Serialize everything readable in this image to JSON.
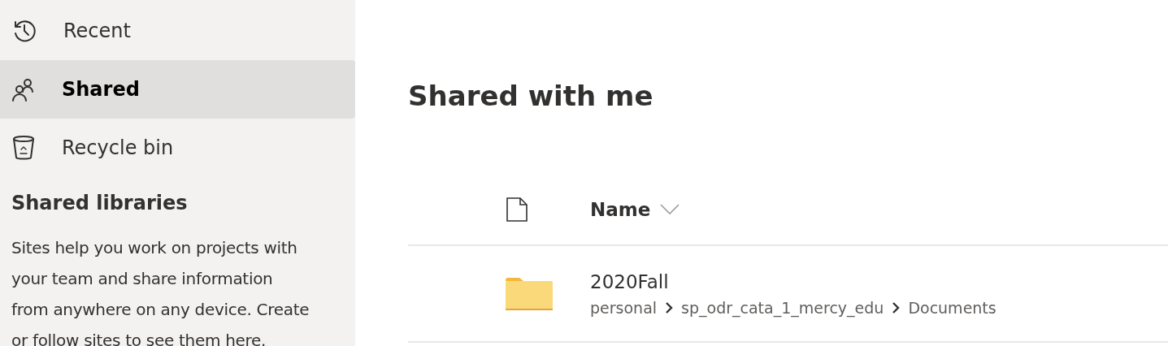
{
  "sidebar": {
    "items": [
      {
        "kind": "recent",
        "label": "Recent",
        "selected": false
      },
      {
        "kind": "shared",
        "label": "Shared",
        "selected": true
      },
      {
        "kind": "recycle",
        "label": "Recycle bin",
        "selected": false
      }
    ],
    "section_title": "Shared libraries",
    "description": "Sites help you work on projects with your team and share information from anywhere on any device. Create or follow sites to see them here."
  },
  "main": {
    "title": "Shared with me",
    "table": {
      "columns": [
        {
          "kind": "type"
        },
        {
          "kind": "name",
          "label": "Name"
        }
      ],
      "rows": [
        {
          "kind": "folder",
          "name": "2020Fall",
          "path": [
            "personal",
            "sp_odr_cata_1_mercy_edu",
            "Documents"
          ]
        }
      ]
    }
  }
}
